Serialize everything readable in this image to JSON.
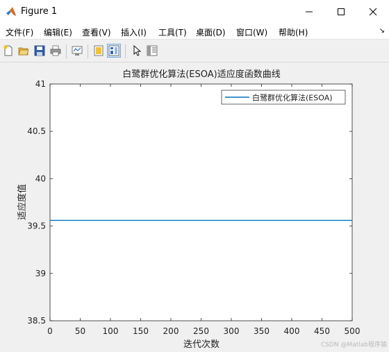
{
  "window": {
    "title": "Figure 1"
  },
  "menubar": {
    "items": [
      {
        "label": "文件(F)"
      },
      {
        "label": "编辑(E)"
      },
      {
        "label": "查看(V)"
      },
      {
        "label": "插入(I)"
      },
      {
        "label": "工具(T)"
      },
      {
        "label": "桌面(D)"
      },
      {
        "label": "窗口(W)"
      },
      {
        "label": "帮助(H)"
      }
    ],
    "overflow_arrow": "↘"
  },
  "toolbar": {
    "buttons": [
      {
        "icon": "new-figure-icon"
      },
      {
        "icon": "open-file-icon"
      },
      {
        "icon": "save-icon"
      },
      {
        "icon": "print-icon"
      },
      {
        "icon": "link-plot-icon"
      },
      {
        "icon": "hide-plot-tools-icon"
      },
      {
        "icon": "show-plot-tools-icon"
      },
      {
        "icon": "edit-plot-arrow-icon"
      },
      {
        "icon": "property-inspector-icon"
      }
    ]
  },
  "plot": {
    "title": "白鹭群优化算法(ESOA)适应度函数曲线",
    "xlabel": "迭代次数",
    "ylabel": "适应度值",
    "watermark": "CSDN @Matlab程序猿"
  },
  "chart_data": {
    "type": "line",
    "title": "白鹭群优化算法(ESOA)适应度函数曲线",
    "xlabel": "迭代次数",
    "ylabel": "适应度值",
    "xlim": [
      0,
      500
    ],
    "ylim": [
      38.5,
      41
    ],
    "x_ticks": [
      "0",
      "50",
      "100",
      "150",
      "200",
      "250",
      "300",
      "350",
      "400",
      "450",
      "500"
    ],
    "y_ticks": [
      "38.5",
      "39",
      "39.5",
      "40",
      "40.5",
      "41"
    ],
    "grid": false,
    "legend_position": "top-right",
    "series": [
      {
        "name": "白鹭群优化算法(ESOA)",
        "color": "#0072bd",
        "x": [
          0,
          500
        ],
        "y": [
          39.56,
          39.56
        ]
      }
    ]
  }
}
